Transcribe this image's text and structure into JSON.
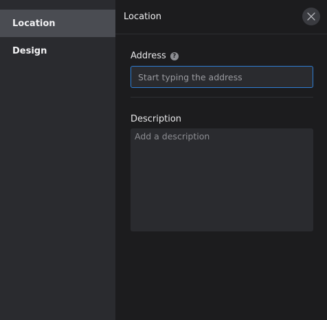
{
  "sidebar": {
    "items": [
      {
        "label": "Location",
        "active": true
      },
      {
        "label": "Design",
        "active": false
      }
    ]
  },
  "header": {
    "title": "Location",
    "close_icon": "close-icon"
  },
  "address": {
    "label": "Address",
    "help_icon": "question-circle-icon",
    "help_glyph": "?",
    "placeholder": "Start typing the address",
    "value": ""
  },
  "description": {
    "label": "Description",
    "placeholder": "Add a description",
    "value": ""
  },
  "colors": {
    "accent": "#2f7fd6",
    "sidebar_bg": "#2a2b2f",
    "active_item_bg": "#4a4c52",
    "panel_bg": "#1c1c1e"
  }
}
